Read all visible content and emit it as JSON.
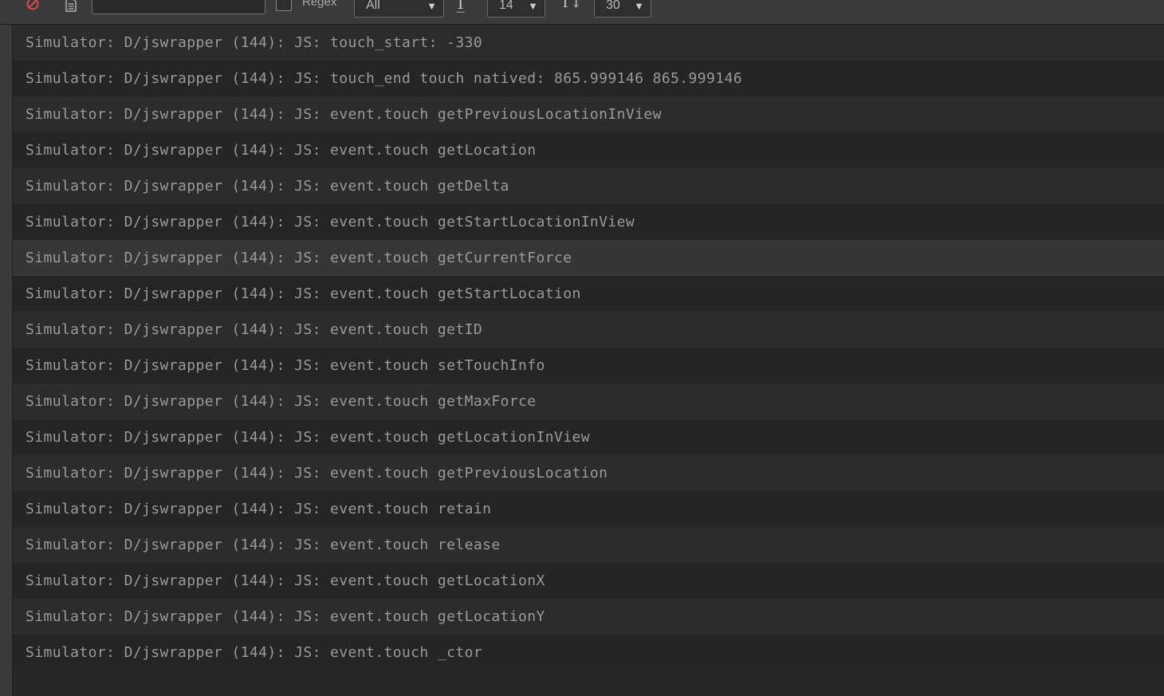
{
  "toolbar": {
    "search": {
      "value": "",
      "placeholder": ""
    },
    "regex_label": "Regex",
    "regex_checked": false,
    "filter_dropdown": {
      "selected": "All"
    },
    "font_size_dropdown": {
      "selected": "14"
    },
    "max_lines_dropdown": {
      "selected": "30"
    },
    "icons": {
      "clear": "clear-console-icon",
      "document": "document-icon",
      "font_size": "font-size-icon",
      "line_height": "line-height-icon"
    },
    "colors": {
      "clear_icon": "#e04848"
    }
  },
  "console": {
    "hovered_row": 6,
    "rows": [
      "Simulator: D/jswrapper (144): JS: touch_start: -330",
      "Simulator: D/jswrapper (144): JS: touch_end touch natived: 865.999146 865.999146",
      "Simulator: D/jswrapper (144): JS: event.touch getPreviousLocationInView",
      "Simulator: D/jswrapper (144): JS: event.touch getLocation",
      "Simulator: D/jswrapper (144): JS: event.touch getDelta",
      "Simulator: D/jswrapper (144): JS: event.touch getStartLocationInView",
      "Simulator: D/jswrapper (144): JS: event.touch getCurrentForce",
      "Simulator: D/jswrapper (144): JS: event.touch getStartLocation",
      "Simulator: D/jswrapper (144): JS: event.touch getID",
      "Simulator: D/jswrapper (144): JS: event.touch setTouchInfo",
      "Simulator: D/jswrapper (144): JS: event.touch getMaxForce",
      "Simulator: D/jswrapper (144): JS: event.touch getLocationInView",
      "Simulator: D/jswrapper (144): JS: event.touch getPreviousLocation",
      "Simulator: D/jswrapper (144): JS: event.touch retain",
      "Simulator: D/jswrapper (144): JS: event.touch release",
      "Simulator: D/jswrapper (144): JS: event.touch getLocationX",
      "Simulator: D/jswrapper (144): JS: event.touch getLocationY",
      "Simulator: D/jswrapper (144): JS: event.touch _ctor"
    ]
  }
}
